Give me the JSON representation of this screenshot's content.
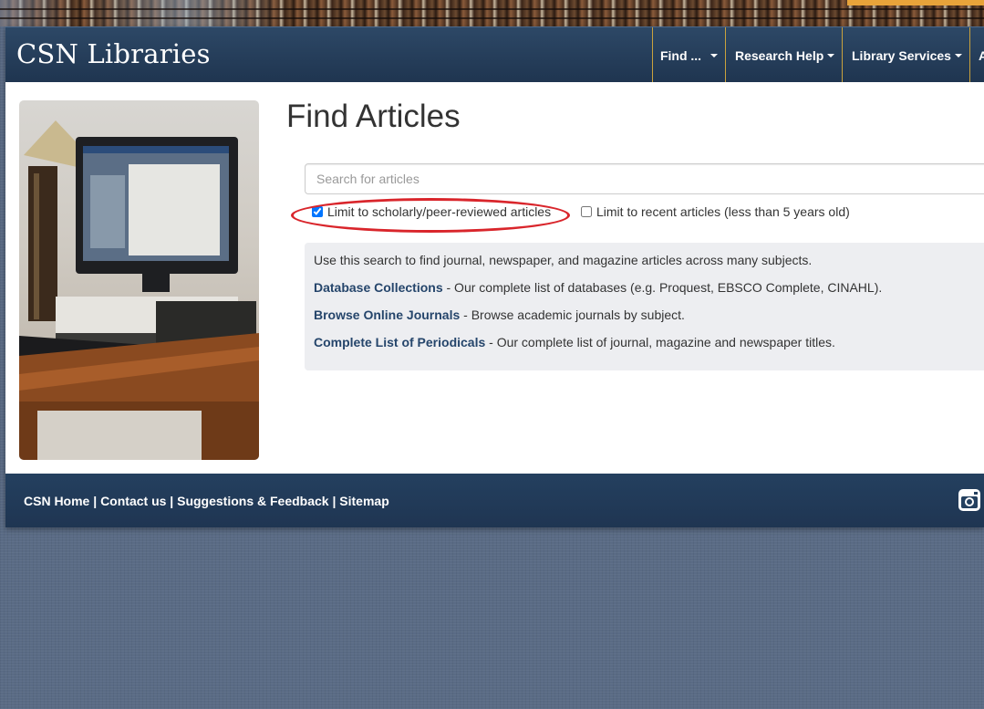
{
  "header": {
    "brand": "CSN Libraries",
    "nav": [
      {
        "label": "Find ..."
      },
      {
        "label": "Research Help"
      },
      {
        "label": "Library Services"
      },
      {
        "label": "A"
      }
    ]
  },
  "main": {
    "title": "Find Articles",
    "search": {
      "placeholder": "Search for articles",
      "value": ""
    },
    "options": {
      "scholarly": {
        "label": "Limit to scholarly/peer-reviewed articles",
        "checked": true
      },
      "recent": {
        "label": "Limit to recent articles (less than 5 years old)",
        "checked": false
      }
    },
    "info": {
      "intro": "Use this search to find journal, newspaper, and magazine articles across many subjects.",
      "links": [
        {
          "label": "Database Collections",
          "desc": " - Our complete list of databases (e.g. Proquest, EBSCO Complete, CINAHL)."
        },
        {
          "label": "Browse Online Journals",
          "desc": " - Browse academic journals by subject."
        },
        {
          "label": "Complete List of Periodicals",
          "desc": " - Our complete list of journal, magazine and newspaper titles."
        }
      ]
    }
  },
  "footer": {
    "links": [
      {
        "label": "CSN Home"
      },
      {
        "label": "Contact us"
      },
      {
        "label": "Suggestions & Feedback"
      },
      {
        "label": "Sitemap"
      }
    ],
    "separator": " | ",
    "social_icon": "instagram-icon"
  },
  "colors": {
    "navbar": "#1f3550",
    "link": "#25456b",
    "annotation": "#d9252b",
    "nav_divider": "#c9a23d"
  }
}
